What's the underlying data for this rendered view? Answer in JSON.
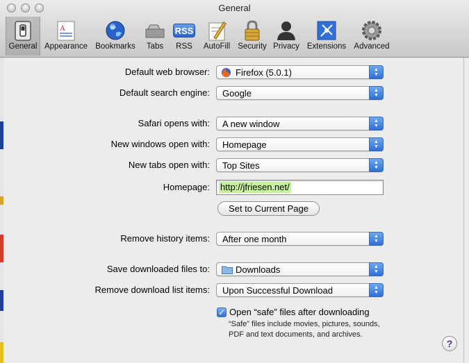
{
  "window": {
    "title": "General"
  },
  "toolbar": {
    "items": [
      {
        "label": "General",
        "icon": "general-switch-icon"
      },
      {
        "label": "Appearance",
        "icon": "appearance-icon"
      },
      {
        "label": "Bookmarks",
        "icon": "globe-icon"
      },
      {
        "label": "Tabs",
        "icon": "tabs-icon"
      },
      {
        "label": "RSS",
        "icon": "rss-icon"
      },
      {
        "label": "AutoFill",
        "icon": "autofill-pencil-icon"
      },
      {
        "label": "Security",
        "icon": "lock-icon"
      },
      {
        "label": "Privacy",
        "icon": "person-silhouette-icon"
      },
      {
        "label": "Extensions",
        "icon": "extensions-icon"
      },
      {
        "label": "Advanced",
        "icon": "gear-icon"
      }
    ],
    "rss_badge": "RSS"
  },
  "settings": {
    "default_browser": {
      "label": "Default web browser:",
      "value": "Firefox (5.0.1)"
    },
    "search_engine": {
      "label": "Default search engine:",
      "value": "Google"
    },
    "safari_opens": {
      "label": "Safari opens with:",
      "value": "A new window"
    },
    "new_windows": {
      "label": "New windows open with:",
      "value": "Homepage"
    },
    "new_tabs": {
      "label": "New tabs open with:",
      "value": "Top Sites"
    },
    "homepage": {
      "label": "Homepage:",
      "value": "http://jfriesen.net/"
    },
    "set_current_page": "Set to Current Page",
    "remove_history": {
      "label": "Remove history items:",
      "value": "After one month"
    },
    "save_downloads": {
      "label": "Save downloaded files to:",
      "value": "Downloads"
    },
    "remove_downloads": {
      "label": "Remove download list items:",
      "value": "Upon Successful Download"
    },
    "open_safe": {
      "label": "Open “safe” files after downloading",
      "checked": true,
      "note_line1": "“Safe” files include movies, pictures, sounds,",
      "note_line2": "PDF and text documents, and archives."
    },
    "help": "?"
  },
  "colors": {
    "accent": "#2f6fd6",
    "selection": "#c6f29c"
  }
}
